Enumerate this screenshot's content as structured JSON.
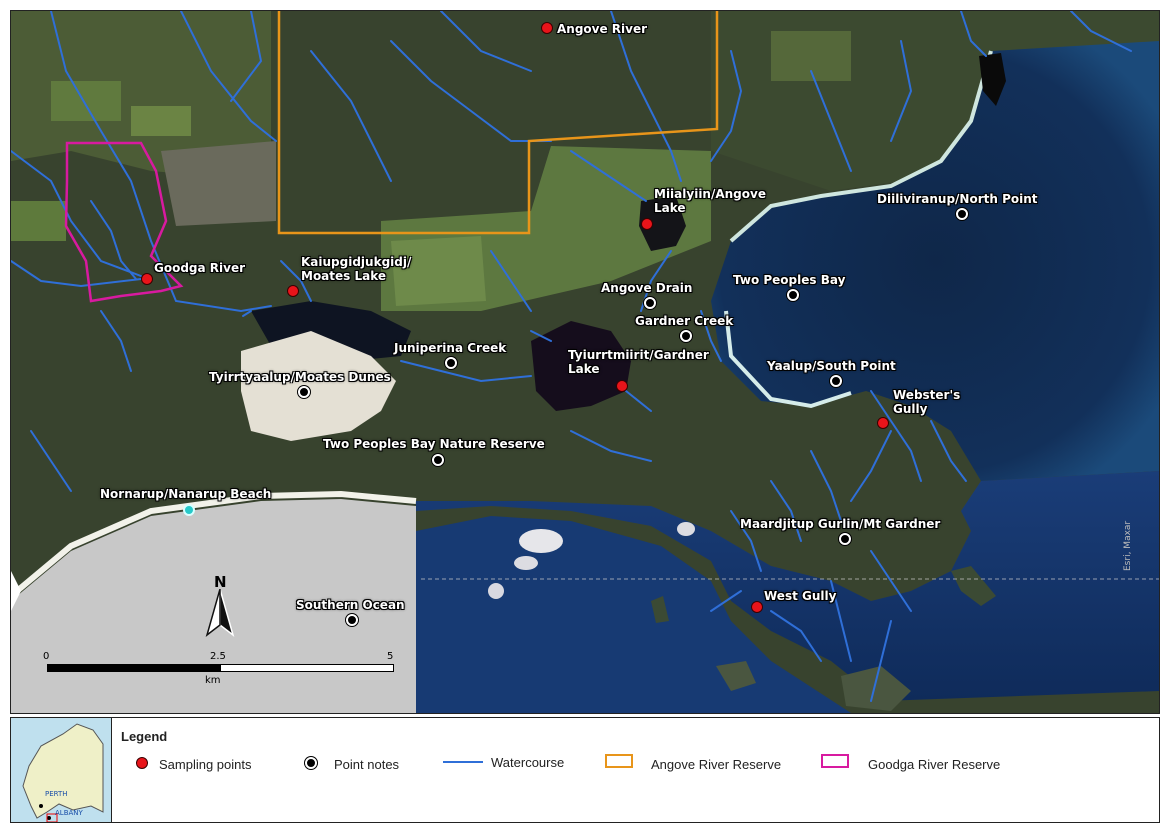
{
  "map": {
    "sampling_points": [
      {
        "label": "Angove River"
      },
      {
        "label": "Goodga River"
      },
      {
        "label": "Kaiupgidjukgidj/\nMoates Lake"
      },
      {
        "label": "Miialyiin/Angove\nLake"
      },
      {
        "label": "Tyiurrtmiirit/Gardner\nLake"
      },
      {
        "label": "Webster's\nGully"
      },
      {
        "label": "West Gully"
      }
    ],
    "point_notes": [
      {
        "label": "Diiliviranup/North Point"
      },
      {
        "label": "Two Peoples Bay"
      },
      {
        "label": "Angove Drain"
      },
      {
        "label": "Gardner Creek"
      },
      {
        "label": "Juniperina Creek"
      },
      {
        "label": "Yaalup/South Point"
      },
      {
        "label": "Tyirrtyaalup/Moates Dunes"
      },
      {
        "label": "Two Peoples Bay Nature Reserve"
      },
      {
        "label": "Maardjitup Gurlin/Mt Gardner"
      },
      {
        "label": "Southern Ocean"
      },
      {
        "label": "Nornarup/Nanarup Beach"
      }
    ],
    "north_arrow": {
      "label": "N"
    },
    "scale_bar": {
      "ticks": [
        "0",
        "2.5",
        "5"
      ],
      "unit": "km"
    },
    "credit": "Esri, Maxar",
    "colors": {
      "sampling": "#e8141a",
      "watercourse": "#2f6fd8",
      "angove_reserve": "#e8951a",
      "goodga_reserve": "#d81aa0",
      "cyan_point": "#27c9c9"
    }
  },
  "legend": {
    "title": "Legend",
    "items": [
      {
        "label": "Sampling points",
        "icon": "red-dot-icon"
      },
      {
        "label": "Point notes",
        "icon": "black-dot-icon"
      },
      {
        "label": "Watercourse",
        "icon": "blue-line-icon"
      },
      {
        "label": "Angove River Reserve",
        "icon": "orange-box-icon"
      },
      {
        "label": "Goodga River Reserve",
        "icon": "magenta-box-icon"
      }
    ],
    "inset": {
      "labels": [
        "PERTH",
        "ALBANY"
      ]
    }
  }
}
